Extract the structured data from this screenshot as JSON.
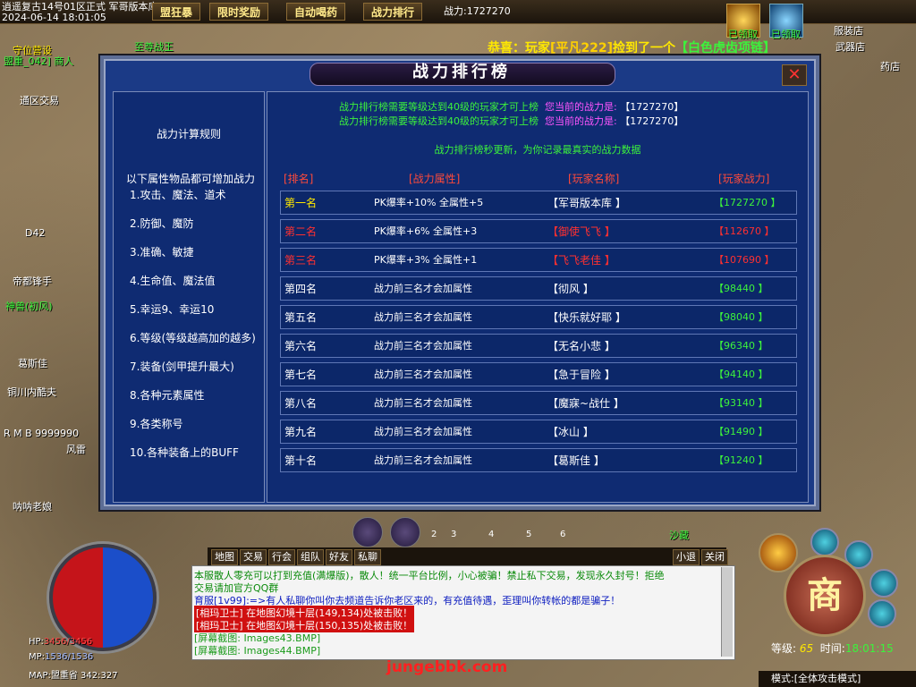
{
  "top_bar": {
    "server_line": "逍遥复古14号01区正式 军哥版本库",
    "datetime": "2024-06-14 18:01:05",
    "buttons": [
      "盟狂暴",
      "限时奖励",
      "自动喝药",
      "战力排行"
    ],
    "power_label": "战力:",
    "power_value": "1727270"
  },
  "announcement": {
    "prefix": "恭喜：玩家",
    "player": "[平凡222]",
    "mid": "捡到了一个",
    "item": "【白色虎齿项链】"
  },
  "map_labels": {
    "npc_1": "守位营设",
    "npc_2": "盟重_042] 商人",
    "npc_3": "通区交易",
    "npc_4": "武器店",
    "npc_5": "服装店",
    "npc_6": "药店",
    "npc_7": "至尊战王",
    "npc_8": "神兽(初风)",
    "npc_9": "葛斯佳",
    "npc_10": "铜川内酷夫",
    "npc_11": "风雷",
    "npc_12": "呐呐老娘",
    "npc_13": "帝都锋手",
    "rmb": "R M B",
    "rmb_value": "9999990",
    "level_tag": "D42",
    "stat_badge_1": "已领取",
    "stat_badge_2": "已领取"
  },
  "dialog": {
    "title": "战力排行榜",
    "close": "✕",
    "rules": {
      "title": "战力计算规则",
      "intro": "以下属性物品都可增加战力",
      "items": [
        "1.攻击、魔法、道术",
        "2.防御、魔防",
        "3.准确、敏捷",
        "4.生命值、魔法值",
        "5.幸运9、幸运10",
        "6.等级(等级越高加的越多)",
        "7.装备(剑甲提升最大)",
        "8.各种元素属性",
        "9.各类称号",
        "10.各种装备上的BUFF"
      ]
    },
    "requirement": {
      "text": "战力排行榜需要等级达到40级的玩家才可上榜",
      "current_label": "您当前的战力是:",
      "current_value": "【1727270】"
    },
    "update_note": "战力排行榜秒更新，为你记录最真实的战力数据",
    "headers": [
      "[排名]",
      "[战力属性]",
      "[玩家名称]",
      "[玩家战力]"
    ],
    "rows": [
      {
        "rank": "第一名",
        "attr": "PK爆率+10%   全属性+5",
        "name": "【军哥版本库      】",
        "power": "【1727270    】"
      },
      {
        "rank": "第二名",
        "attr": "PK爆率+6%    全属性+3",
        "name": "【御使飞飞        】",
        "power": "【112670     】"
      },
      {
        "rank": "第三名",
        "attr": "PK爆率+3%    全属性+1",
        "name": "【飞飞老佳        】",
        "power": "【107690     】"
      },
      {
        "rank": "第四名",
        "attr": "战力前三名才会加属性",
        "name": "【彻风            】",
        "power": "【98440      】"
      },
      {
        "rank": "第五名",
        "attr": "战力前三名才会加属性",
        "name": "【快乐就好耶      】",
        "power": "【98040      】"
      },
      {
        "rank": "第六名",
        "attr": "战力前三名才会加属性",
        "name": "【无名小悲        】",
        "power": "【96340      】"
      },
      {
        "rank": "第七名",
        "attr": "战力前三名才会加属性",
        "name": "【急于冒险        】",
        "power": "【94140      】"
      },
      {
        "rank": "第八名",
        "attr": "战力前三名才会加属性",
        "name": "【魔寐~战仕       】",
        "power": "【93140      】"
      },
      {
        "rank": "第九名",
        "attr": "战力前三名才会加属性",
        "name": "【冰山            】",
        "power": "【91490      】"
      },
      {
        "rank": "第十名",
        "attr": "战力前三名才会加属性",
        "name": "【葛斯佳          】",
        "power": "【91240      】"
      }
    ]
  },
  "hud": {
    "hp_label": "HP:",
    "hp_value": "3456/3456",
    "mp_label": "MP:",
    "mp_value": "1536/1536",
    "map_label": "MAP:",
    "map_value": "盟重省 342:327",
    "chat_tabs": [
      "地图",
      "交易",
      "行会",
      "组队",
      "好友",
      "私聊"
    ],
    "chat_right": [
      "小退",
      "关闭"
    ],
    "chat_lines": [
      {
        "text": "本服散人零充可以打到充值(满爆版)，散人！统一平台比例，小心被骗！禁止私下交易，发现永久封号！拒绝",
        "color": "#0a8a0a"
      },
      {
        "text": "交易请加官方QQ群",
        "color": "#0a8a0a"
      },
      {
        "text": "育服[1v99]:=>有人私聊你叫你去频道告诉你老区来的，有充值待遇，歪理叫你转帐的都是骗子！",
        "color": "#1020c0"
      },
      {
        "text": "[相玛卫士] 在地图幻境十层(149,134)处被击败！",
        "color": "#ffffff",
        "bg": "#d01010"
      },
      {
        "text": "[相玛卫士] 在地图幻境十层(150,135)处被击败！",
        "color": "#ffffff",
        "bg": "#d01010"
      },
      {
        "text": "[屏幕截图: Images43.BMP]",
        "color": "#1a9a1a"
      },
      {
        "text": "[屏幕截图: Images44.BMP]",
        "color": "#1a9a1a"
      }
    ],
    "slots": [
      "2",
      "3",
      "4",
      "5",
      "6"
    ],
    "shop": "商",
    "level_label": "等级:",
    "level_value": "65",
    "time_label": "时间:",
    "time_value": "18:01:15",
    "mode": "模式:[全体攻击模式]",
    "watermark": "jungebbk.com",
    "map_event": "沙藏"
  }
}
